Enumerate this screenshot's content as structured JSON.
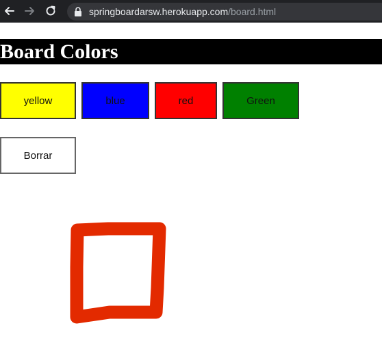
{
  "browser": {
    "url_host": "springboardarsw.herokuapp.com",
    "url_path": "/board.html",
    "icons": [
      "back-arrow-icon",
      "forward-arrow-icon",
      "reload-icon",
      "lock-icon"
    ]
  },
  "page": {
    "title": "Board Colors"
  },
  "color_buttons": [
    {
      "label": "yellow",
      "color": "#ffff00"
    },
    {
      "label": "blue",
      "color": "#0000ff"
    },
    {
      "label": "red",
      "color": "#ff0000"
    },
    {
      "label": "Green",
      "color": "#008000"
    }
  ],
  "clear_button": {
    "label": "Borrar"
  },
  "board": {
    "stroke_color": "#e32a00"
  }
}
